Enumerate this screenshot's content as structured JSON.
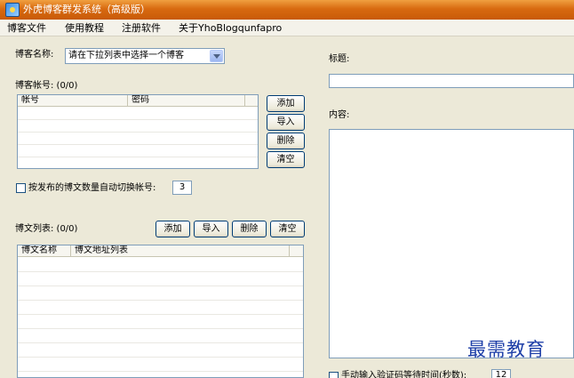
{
  "window": {
    "title": "外虎博客群发系统（高级版）"
  },
  "menu": [
    "博客文件",
    "使用教程",
    "注册软件",
    "关于YhoBlogqunfapro"
  ],
  "left": {
    "blog_name_label": "博客名称:",
    "blog_select_value": "请在下拉列表中选择一个博客",
    "accounts_label": "博客帐号: (0/0)",
    "accounts_columns": [
      "帐号",
      "密码"
    ],
    "account_buttons": [
      "添加",
      "导入",
      "删除",
      "清空"
    ],
    "auto_switch_label": "按发布的博文数量自动切换帐号:",
    "auto_switch_value": "3",
    "posts_label": "博文列表: (0/0)",
    "post_buttons": [
      "添加",
      "导入",
      "删除",
      "清空"
    ],
    "posts_columns": [
      "博文名称",
      "博文地址列表"
    ]
  },
  "right": {
    "title_label": "标题:",
    "content_label": "内容:",
    "captcha_label": "手动输入验证码等待时间(秒数):",
    "captcha_value": "12"
  },
  "watermark": "最需教育"
}
